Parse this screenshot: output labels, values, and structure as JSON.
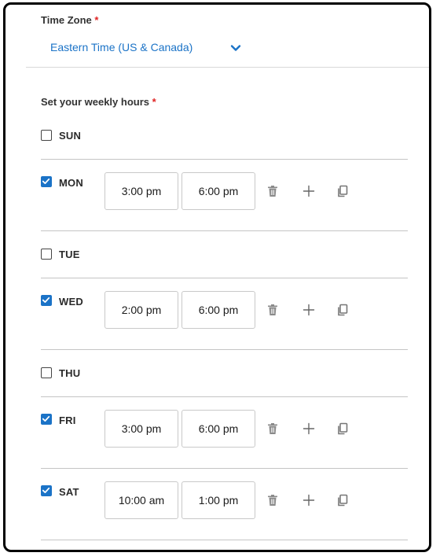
{
  "timezone": {
    "label": "Time Zone",
    "required_mark": "*",
    "value": "Eastern Time (US & Canada)",
    "chevron_icon": "chevron-down-icon",
    "accent_color": "#1b73c7"
  },
  "weekly_hours": {
    "label": "Set your weekly hours",
    "required_mark": "*",
    "days": [
      {
        "name": "SUN",
        "checked": false
      },
      {
        "name": "MON",
        "checked": true,
        "start": "3:00 pm",
        "end": "6:00 pm"
      },
      {
        "name": "TUE",
        "checked": false
      },
      {
        "name": "WED",
        "checked": true,
        "start": "2:00 pm",
        "end": "6:00 pm"
      },
      {
        "name": "THU",
        "checked": false
      },
      {
        "name": "FRI",
        "checked": true,
        "start": "3:00 pm",
        "end": "6:00 pm"
      },
      {
        "name": "SAT",
        "checked": true,
        "start": "10:00 am",
        "end": "1:00 pm"
      }
    ],
    "row_icons": [
      "trash-icon",
      "plus-icon",
      "copy-icon"
    ]
  }
}
